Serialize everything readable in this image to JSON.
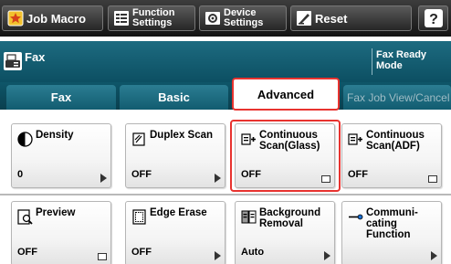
{
  "toolbar": {
    "job_macro": "Job Macro",
    "function_settings": [
      "Function",
      "Settings"
    ],
    "device_settings": [
      "Device",
      "Settings"
    ],
    "reset": "Reset",
    "help": "?"
  },
  "titlebar": {
    "title": "Fax",
    "status": [
      "Fax Ready",
      "Mode"
    ]
  },
  "tabs": {
    "fax": "Fax",
    "basic": "Basic",
    "advanced": "Advanced",
    "job_view": "Fax Job View/Cancel"
  },
  "functions": [
    {
      "title": [
        "Density"
      ],
      "value": "0",
      "indicator": "arrow",
      "icon": "density-icon"
    },
    {
      "title": [
        "Duplex Scan"
      ],
      "value": "OFF",
      "indicator": "arrow",
      "icon": "duplex-scan-icon"
    },
    {
      "title": [
        "Continuous",
        "Scan(Glass)"
      ],
      "value": "OFF",
      "indicator": "window",
      "icon": "continuous-scan-icon",
      "selected": true
    },
    {
      "title": [
        "Continuous",
        "Scan(ADF)"
      ],
      "value": "OFF",
      "indicator": "window",
      "icon": "continuous-scan-icon"
    },
    {
      "title": [
        "Preview"
      ],
      "value": "OFF",
      "indicator": "window",
      "icon": "preview-icon"
    },
    {
      "title": [
        "Edge Erase"
      ],
      "value": "OFF",
      "indicator": "arrow",
      "icon": "edge-erase-icon"
    },
    {
      "title": [
        "Background",
        "Removal"
      ],
      "value": "Auto",
      "indicator": "arrow",
      "icon": "background-removal-icon"
    },
    {
      "title": [
        "Communi-",
        "cating",
        "Function"
      ],
      "value": "",
      "indicator": "arrow",
      "icon": "communicating-function-icon"
    }
  ],
  "colors": {
    "highlight": "#e8332f",
    "titlebar": "#0c4f62",
    "toolbar": "#141414"
  }
}
